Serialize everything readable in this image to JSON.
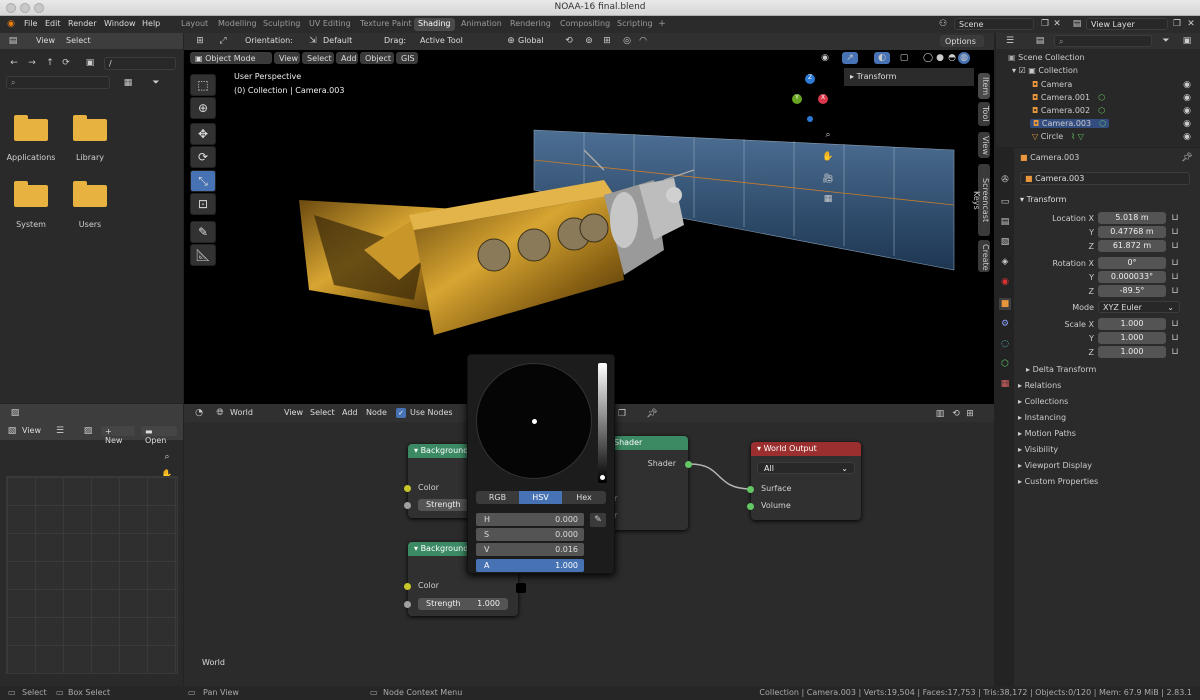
{
  "window": {
    "title": "NOAA-16 final.blend"
  },
  "menu": {
    "items": [
      "File",
      "Edit",
      "Render",
      "Window",
      "Help"
    ]
  },
  "workspaces": [
    {
      "label": "Layout"
    },
    {
      "label": "Modelling"
    },
    {
      "label": "Sculpting"
    },
    {
      "label": "UV Editing"
    },
    {
      "label": "Texture Paint"
    },
    {
      "label": "Shading",
      "active": true
    },
    {
      "label": "Animation"
    },
    {
      "label": "Rendering"
    },
    {
      "label": "Compositing"
    },
    {
      "label": "Scripting"
    }
  ],
  "scene": {
    "name": "Scene",
    "view_layer": "View Layer"
  },
  "filebrowser": {
    "menu": [
      "View",
      "Select"
    ],
    "path": "/",
    "search_placeholder": "",
    "folders": [
      "Applications",
      "Library",
      "System",
      "Users"
    ]
  },
  "imageeditor": {
    "view": "View",
    "new": "New",
    "open": "Open"
  },
  "viewport": {
    "mode": "Object Mode",
    "menus": [
      "View",
      "Select",
      "Add",
      "Object",
      "GIS"
    ],
    "orientation_label": "Orientation:",
    "orientation": "Default",
    "drag_label": "Drag:",
    "drag": "Active Tool",
    "transform_orientation": "Global",
    "options": "Options",
    "perspective": "User Perspective",
    "collection_info": "(0) Collection | Camera.003",
    "transform_panel": "Transform",
    "side_tabs": [
      "Item",
      "Tool",
      "View",
      "Screencast Keys",
      "Create"
    ],
    "gizmo": {
      "z": "Z",
      "y": "Y",
      "x": "X"
    }
  },
  "nodeeditor": {
    "world": "World",
    "menus": [
      "View",
      "Select",
      "Add",
      "Node"
    ],
    "use_nodes": "Use Nodes",
    "world_label": "World",
    "nodes": {
      "bg1": {
        "title": "Background",
        "out": "Ba",
        "color": "Color",
        "strength": "Strength"
      },
      "bg2": {
        "title": "Background",
        "out": "Ba",
        "color": "Color",
        "strength": "Strength",
        "strength_val": "1.000"
      },
      "mix": {
        "title": "Shader",
        "out": "Shader",
        "in1": "r",
        "in2": "r"
      },
      "out": {
        "title": "World Output",
        "target": "All",
        "surface": "Surface",
        "volume": "Volume"
      }
    },
    "colorpicker": {
      "tabs": [
        "RGB",
        "HSV",
        "Hex"
      ],
      "active_tab": "HSV",
      "fields": [
        {
          "label": "H",
          "value": "0.000"
        },
        {
          "label": "S",
          "value": "0.000"
        },
        {
          "label": "V",
          "value": "0.016"
        },
        {
          "label": "A",
          "value": "1.000"
        }
      ]
    }
  },
  "outliner": {
    "root": "Scene Collection",
    "items": [
      "Collection",
      "Camera",
      "Camera.001",
      "Camera.002",
      "Camera.003",
      "Circle"
    ]
  },
  "properties": {
    "object": "Camera.003",
    "object_field": "Camera.003",
    "transform": "Transform",
    "location_label": "Location X",
    "location": [
      "5.018 m",
      "0.47768 m",
      "61.872 m"
    ],
    "rotation_label": "Rotation X",
    "rotation": [
      "0°",
      "0.000033°",
      "-89.5°"
    ],
    "mode_label": "Mode",
    "mode": "XYZ Euler",
    "scale_label": "Scale X",
    "scale": [
      "1.000",
      "1.000",
      "1.000"
    ],
    "axis_y": "Y",
    "axis_z": "Z",
    "delta": "Delta Transform",
    "sections": [
      "Relations",
      "Collections",
      "Instancing",
      "Motion Paths",
      "Visibility",
      "Viewport Display",
      "Custom Properties"
    ]
  },
  "status": {
    "left": [
      "Select",
      "Box Select",
      "Pan View",
      "Node Context Menu"
    ],
    "right": "Collection | Camera.003 | Verts:19,504 | Faces:17,753 | Tris:38,172 | Objects:0/120 | Mem: 67.9 MiB | 2.83.1"
  },
  "colors": {
    "accent": "#4772b3",
    "node_green": "#3c8a63",
    "node_red": "#9b2e2e",
    "socket_yellow": "#c7c729",
    "socket_gray": "#a1a1a1",
    "socket_green": "#63c763"
  }
}
